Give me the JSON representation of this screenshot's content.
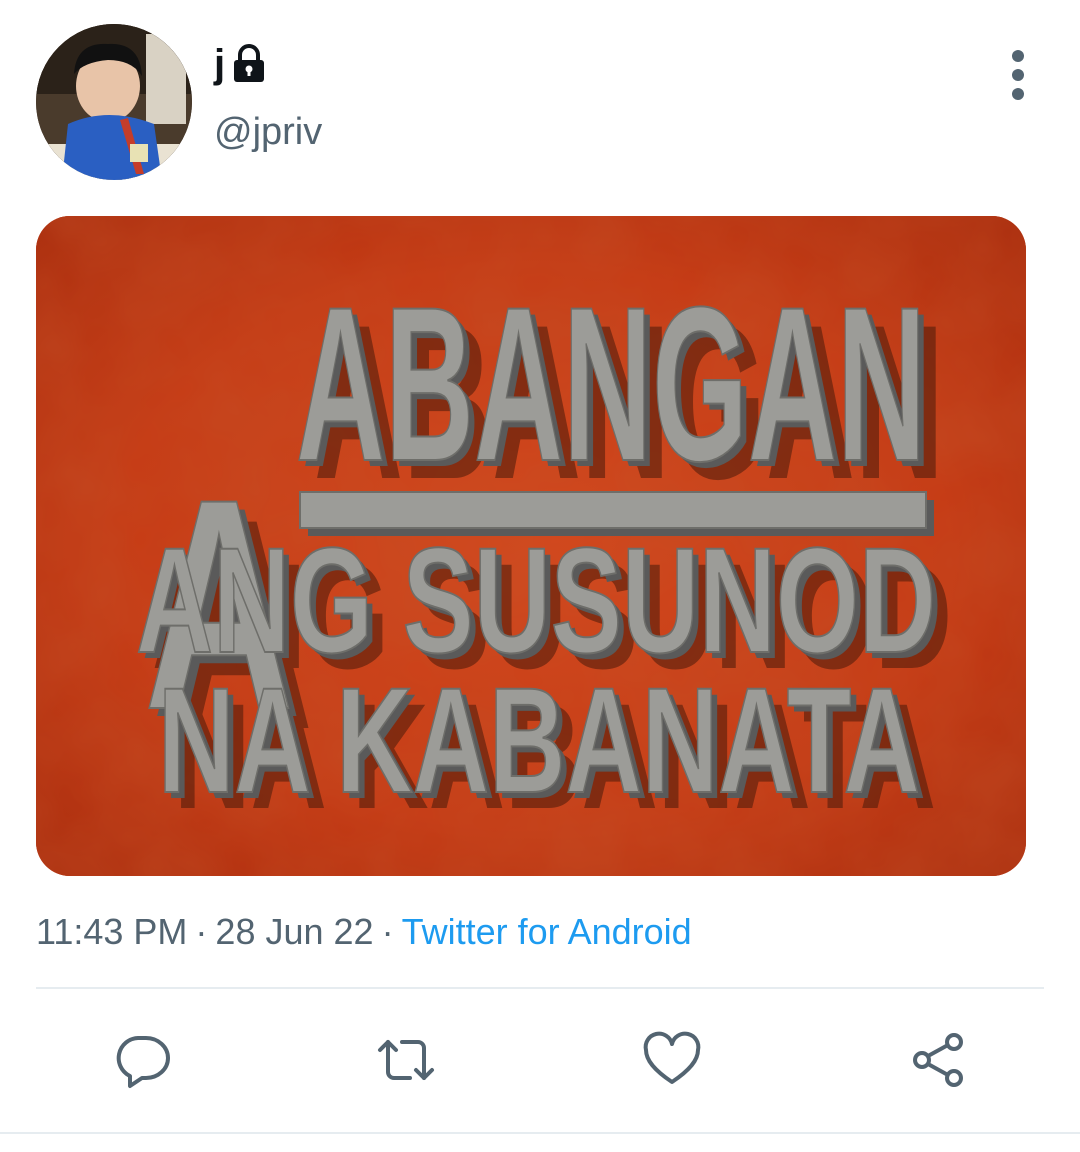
{
  "tweet": {
    "display_name": "j",
    "handle": "@jpriv",
    "time": "11:43 PM",
    "date": "28 Jun 22",
    "separator": "·",
    "source": "Twitter for Android",
    "media": {
      "line1": "ABANGAN",
      "line2": "ANG SUSUNOD",
      "line3": "NA KABANATA"
    }
  },
  "icons": {
    "private": "lock-icon",
    "more": "more-vertical-icon",
    "reply": "reply-icon",
    "retweet": "retweet-icon",
    "like": "heart-icon",
    "share": "share-icon"
  },
  "colors": {
    "text_primary": "#0f1419",
    "text_secondary": "#536471",
    "link": "#1d9bf0",
    "divider": "#e6ecf0"
  }
}
